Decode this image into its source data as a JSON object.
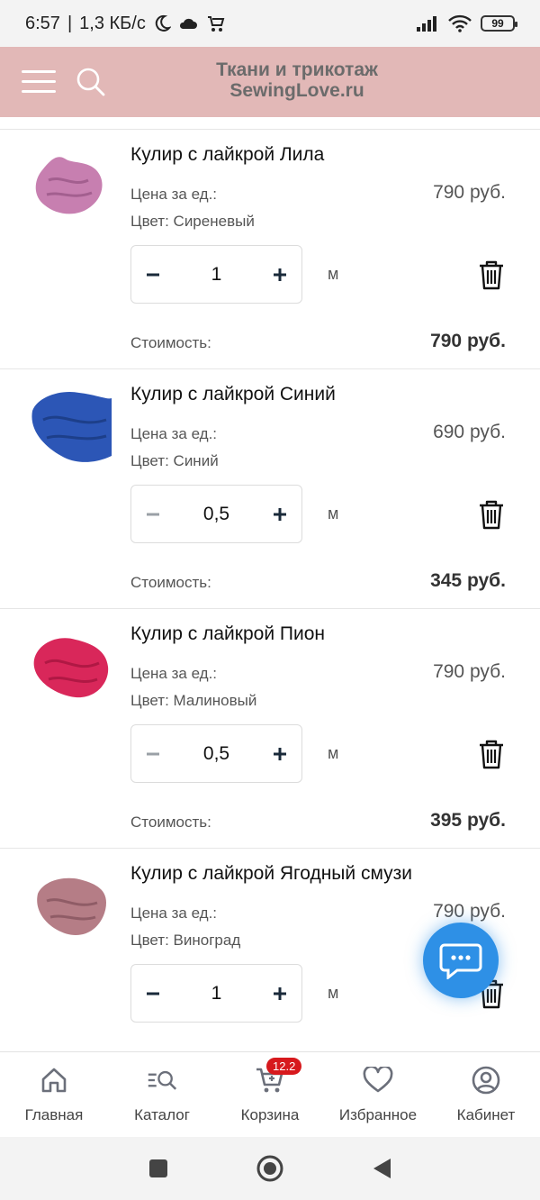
{
  "status_bar": {
    "time": "6:57",
    "speed": "1,3 КБ/с",
    "battery": "99"
  },
  "header": {
    "logo_line1": "Ткани и трикотаж",
    "logo_line2": "SewingLove.ru"
  },
  "labels": {
    "price_per_unit": "Цена за ед.:",
    "cost": "Стоимость:",
    "minus": "−",
    "plus": "+"
  },
  "cart": {
    "items": [
      {
        "title": "Кулир с лайкрой Лила",
        "price": "790 руб.",
        "color": "Цвет: Сиреневый",
        "qty": "1",
        "unit": "м",
        "cost": "790 руб.",
        "swatch": "#c77fb0"
      },
      {
        "title": "Кулир с лайкрой Синий",
        "price": "690 руб.",
        "color": "Цвет: Синий",
        "qty": "0,5",
        "unit": "м",
        "cost": "345 руб.",
        "swatch": "#2c56b6"
      },
      {
        "title": "Кулир с лайкрой Пион",
        "price": "790 руб.",
        "color": "Цвет: Малиновый",
        "qty": "0,5",
        "unit": "м",
        "cost": "395 руб.",
        "swatch": "#d9275a"
      },
      {
        "title": "Кулир с лайкрой Ягодный смузи",
        "price": "790 руб.",
        "color": "Цвет: Виноград",
        "qty": "1",
        "unit": "м",
        "cost": "",
        "swatch": "#b57d86"
      }
    ]
  },
  "bottom_nav": {
    "items": [
      {
        "label": "Главная",
        "icon": "home-icon"
      },
      {
        "label": "Каталог",
        "icon": "catalog-search-icon"
      },
      {
        "label": "Корзина",
        "icon": "cart-icon",
        "badge": "12.2"
      },
      {
        "label": "Избранное",
        "icon": "heart-icon"
      },
      {
        "label": "Кабинет",
        "icon": "user-icon"
      }
    ]
  },
  "colors": {
    "header_bg": "#e2b8b7",
    "chat_fab": "#2e90e6",
    "badge": "#d7191d"
  }
}
